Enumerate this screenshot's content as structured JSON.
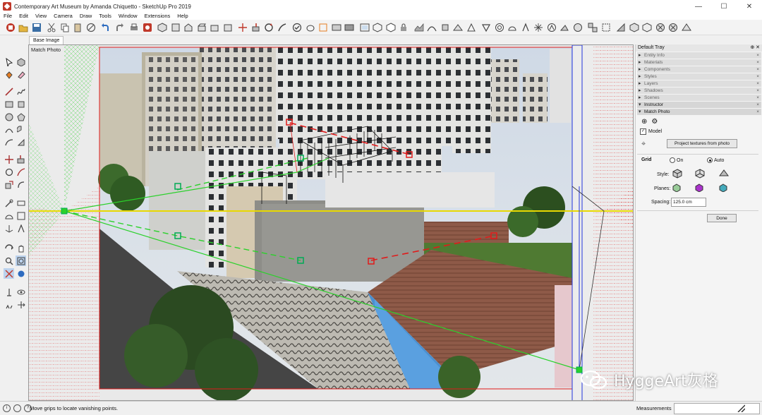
{
  "window": {
    "title": "Contemporary Art Museum by Amanda Chiquetto - SketchUp Pro 2019",
    "minimize_glyph": "—",
    "maximize_glyph": "☐",
    "close_glyph": "✕"
  },
  "menu": {
    "file": "File",
    "edit": "Edit",
    "view": "View",
    "camera": "Camera",
    "draw": "Draw",
    "tools": "Tools",
    "window": "Window",
    "extensions": "Extensions",
    "help": "Help"
  },
  "tabs": {
    "scene_tab": "Base Image"
  },
  "viewport": {
    "label": "Match Photo"
  },
  "tray": {
    "title": "Default Tray",
    "title_icons": "⊕ ✕",
    "panels": {
      "entity_info": "Entity Info",
      "materials": "Materials",
      "components": "Components",
      "styles": "Styles",
      "layers": "Layers",
      "shadows": "Shadows",
      "scenes": "Scenes",
      "instructor": "Instructor",
      "match_photo": "Match Photo"
    },
    "close_glyph": "×",
    "match_photo": {
      "model_label": "Model",
      "model_checked": true,
      "project_button": "Project textures from photo",
      "grid_label": "Grid",
      "grid_on": "On",
      "grid_auto": "Auto",
      "grid_selected": "Auto",
      "style_label": "Style:",
      "planes_label": "Planes:",
      "spacing_label": "Spacing:",
      "spacing_value": "125.0 cm",
      "done_button": "Done"
    }
  },
  "status": {
    "message": "Move grips to locate vanishing points.",
    "measurements_label": "Measurements"
  },
  "watermark": {
    "text": "HyggeArt灰格"
  },
  "colors": {
    "green_axis": "#2bd12b",
    "red_axis": "#e01b1b",
    "horizon": "#e8d800",
    "blue_axis": "#2233dd",
    "accent": "#c0392b"
  }
}
